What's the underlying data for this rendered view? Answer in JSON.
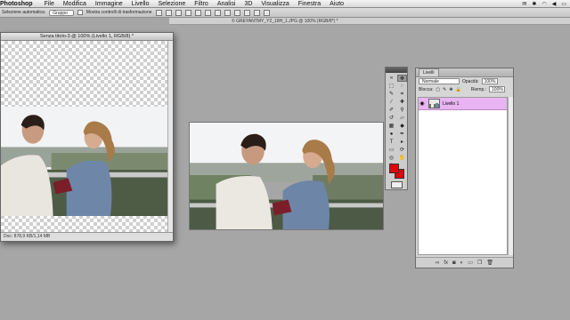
{
  "menubar": {
    "app_name": "Photoshop",
    "items": [
      "File",
      "Modifica",
      "Immagine",
      "Livello",
      "Selezione",
      "Filtro",
      "Analisi",
      "3D",
      "Visualizza",
      "Finestra",
      "Aiuto"
    ]
  },
  "options": {
    "auto_select_label": "Selezione automatica:",
    "auto_select_value": "Gruppo",
    "show_transform_label": "Mostra controlli di trasformazione"
  },
  "app_title": "© GREYANTMY_Y2_18H_1.JPG @ 100% (RGB/8*) *",
  "doc1": {
    "title": "Senza titolo-3 @ 100% (Livello 1, RGB/8) *",
    "status": "Doc: 878,9 KB/1,14 MB"
  },
  "layers_panel": {
    "tab": "Livelli",
    "blend_mode": "Normale",
    "opacity_label": "Opacità:",
    "opacity_value": "100%",
    "lock_label": "Blocca:",
    "fill_label": "Riemp.:",
    "fill_value": "100%",
    "layer_name": "Livello 1"
  },
  "tools": {
    "foreground_color": "#e0000b",
    "background_color": "#e0000b"
  }
}
